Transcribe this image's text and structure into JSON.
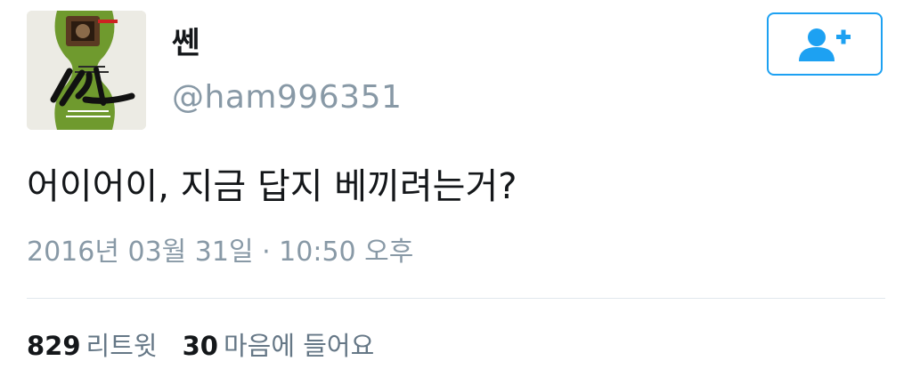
{
  "tweet": {
    "display_name": "쎈",
    "handle": "@ham996351",
    "text": "어이어이, 지금 답지 베끼려는거?",
    "timestamp": "2016년 03월 31일 · 10:50 오후",
    "retweets": {
      "count": "829",
      "label": "리트윗"
    },
    "likes": {
      "count": "30",
      "label": "마음에 들어요"
    }
  },
  "avatar": {
    "cover_title": "쎈",
    "cover_subtitle": "중등 수학 ③(상)"
  },
  "follow_button": {
    "icon": "add-user-icon"
  },
  "colors": {
    "accent": "#1da1f2",
    "text": "#14171a",
    "muted": "#8899a6",
    "divider": "#e1e8ed"
  }
}
